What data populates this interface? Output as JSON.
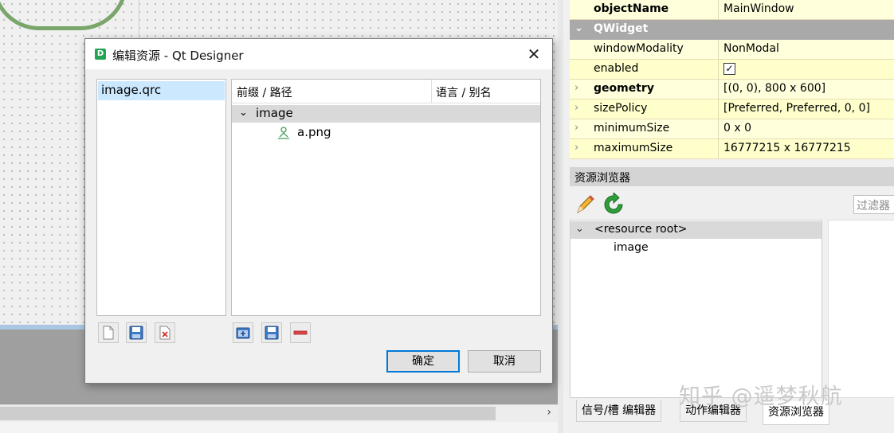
{
  "dialog": {
    "title": "编辑资源 - Qt Designer",
    "app_icon_letter": "D",
    "qrc_files": [
      "image.qrc"
    ],
    "tree_headers": {
      "path": "前缀 / 路径",
      "alias": "语言 / 别名"
    },
    "tree": {
      "prefix": "image",
      "file": "a.png"
    },
    "ok_label": "确定",
    "cancel_label": "取消"
  },
  "properties": {
    "rows": [
      {
        "name": "objectName",
        "value": "MainWindow",
        "bold": true,
        "expandable": false
      },
      {
        "group": "QWidget"
      },
      {
        "name": "windowModality",
        "value": "NonModal",
        "bold": false,
        "expandable": false
      },
      {
        "name": "enabled",
        "value": "✓",
        "bold": false,
        "expandable": false,
        "checkbox": true
      },
      {
        "name": "geometry",
        "value": "[(0, 0), 800 x 600]",
        "bold": true,
        "expandable": true
      },
      {
        "name": "sizePolicy",
        "value": "[Preferred, Preferred, 0, 0]",
        "bold": false,
        "expandable": true
      },
      {
        "name": "minimumSize",
        "value": "0 x 0",
        "bold": false,
        "expandable": true
      },
      {
        "name": "maximumSize",
        "value": "16777215 x 16777215",
        "bold": false,
        "expandable": true
      }
    ]
  },
  "resource_browser": {
    "title": "资源浏览器",
    "filter_placeholder": "过滤器",
    "root": "<resource root>",
    "child": "image"
  },
  "bottom_tabs": [
    "信号/槽 编辑器",
    "动作编辑器",
    "资源浏览器"
  ],
  "watermark": "知乎 @遥梦秋航",
  "scroll_arrow": "›",
  "colors": {
    "accent": "#0078d7",
    "selection": "#cce8ff",
    "prop_bg": "#ffffdc",
    "group_bg": "#a9a9a9"
  }
}
